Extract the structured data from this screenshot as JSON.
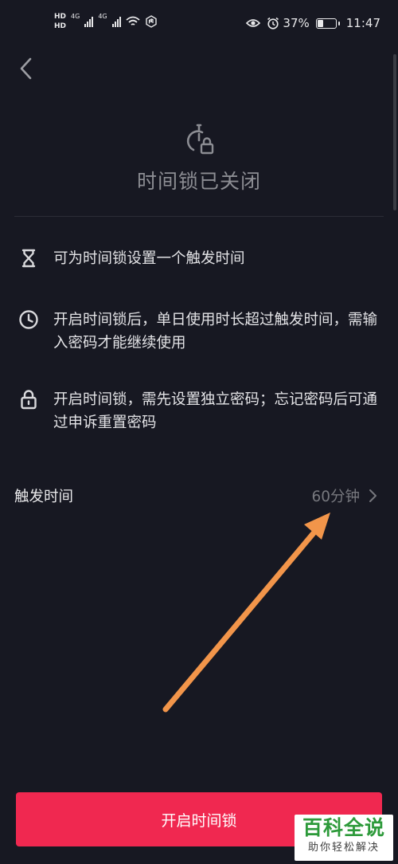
{
  "status_bar": {
    "network_left": [
      "HD",
      "HD"
    ],
    "network_type_1": "4G",
    "network_type_2": "4G",
    "battery_percent": "37%",
    "battery_level": 0.37,
    "time": "11:47",
    "icons": [
      "eye-icon",
      "alarm-icon",
      "wifi-icon",
      "nfc-icon"
    ]
  },
  "header": {
    "back_icon": "chevron-left-icon"
  },
  "hero": {
    "icon": "timer-lock-icon",
    "title": "时间锁已关闭"
  },
  "features": [
    {
      "icon": "hourglass-icon",
      "text": "可为时间锁设置一个触发时间"
    },
    {
      "icon": "clock-icon",
      "text": "开启时间锁后，单日使用时长超过触发时间，需输入密码才能继续使用"
    },
    {
      "icon": "lock-icon",
      "text": "开启时间锁，需先设置独立密码；忘记密码后可通过申诉重置密码"
    }
  ],
  "trigger_time": {
    "label": "触发时间",
    "value": "60分钟"
  },
  "primary_button": {
    "label": "开启时间锁"
  },
  "watermark": {
    "title": "百科全说",
    "subtitle": "助你轻松解决"
  },
  "colors": {
    "background": "#171822",
    "accent": "#f02850",
    "annotation_arrow": "#f2954a"
  }
}
